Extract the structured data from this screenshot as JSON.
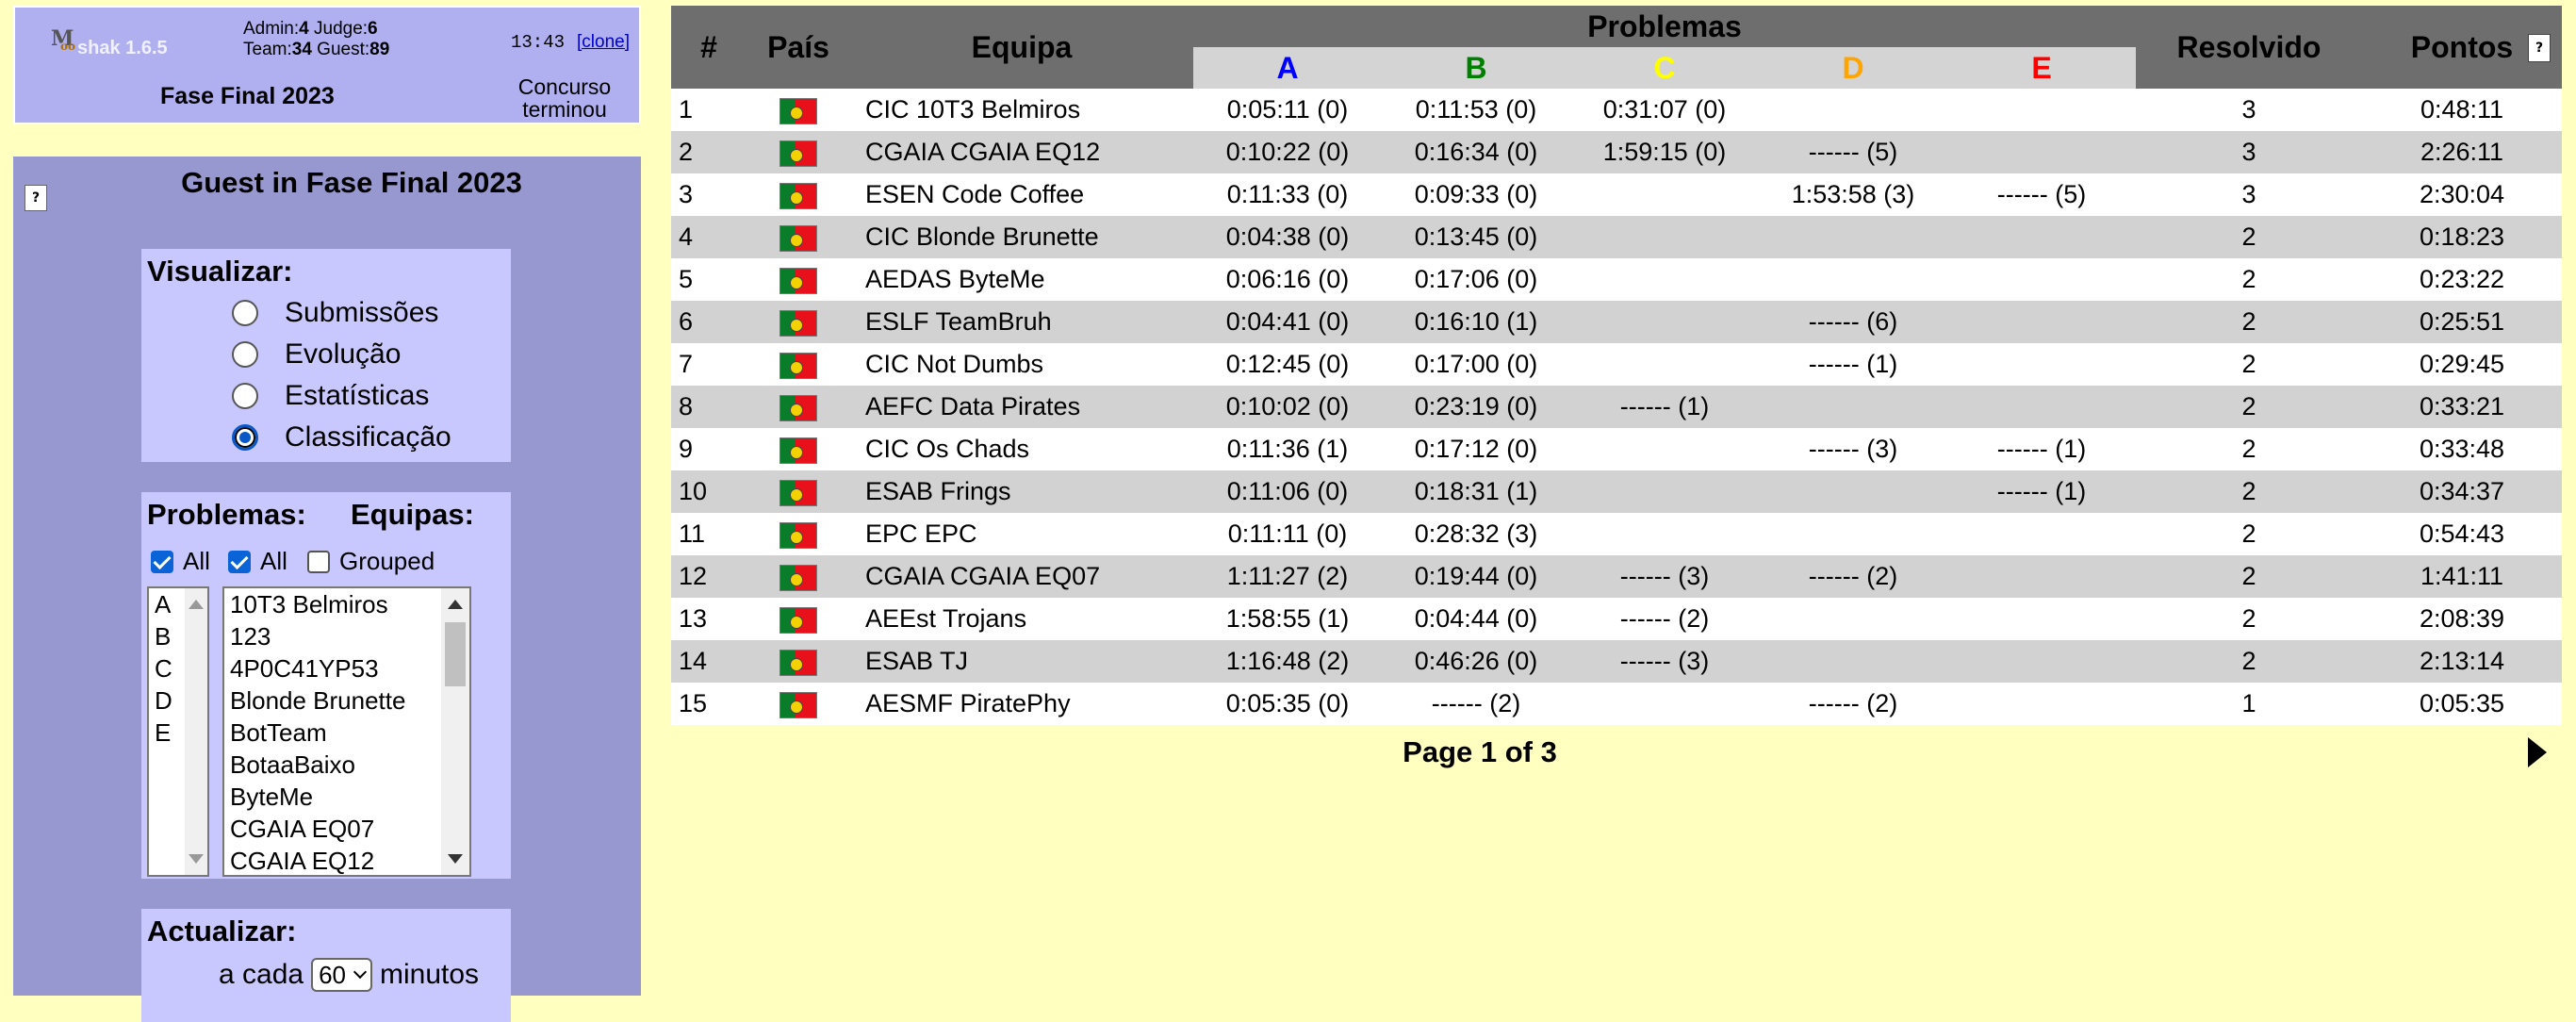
{
  "header": {
    "app_name": "shak 1.6.5",
    "logo_letter": "M",
    "logo_sub": "oo",
    "counts": {
      "admin_label": "Admin:",
      "admin": "4",
      "judge_label": "Judge:",
      "judge": "6",
      "team_label": "Team:",
      "team": "34",
      "guest_label": "Guest:",
      "guest": "89"
    },
    "clock": "13:43",
    "clone_label": "[clone]",
    "contest_name": "Fase Final 2023",
    "contest_status_line1": "Concurso",
    "contest_status_line2": "terminou"
  },
  "sidebar": {
    "title": "Guest in Fase Final 2023",
    "help_icon": "?",
    "view": {
      "title": "Visualizar:",
      "options": [
        "Submissões",
        "Evolução",
        "Estatísticas",
        "Classificação"
      ],
      "selected": "Classificação"
    },
    "filters": {
      "problems_title": "Problemas:",
      "teams_title": "Equipas:",
      "problems_all_label": "All",
      "teams_all_label": "All",
      "grouped_label": "Grouped",
      "problems": [
        "A",
        "B",
        "C",
        "D",
        "E"
      ],
      "teams": [
        "10T3 Belmiros",
        "123",
        "4P0C41YP53",
        "Blonde Brunette",
        "BotTeam",
        "BotaaBaixo",
        "ByteMe",
        "CGAIA EQ07",
        "CGAIA EQ12"
      ]
    },
    "refresh": {
      "title": "Actualizar:",
      "prefix": "a cada",
      "value": "60",
      "suffix": "minutos"
    }
  },
  "scoreboard": {
    "headers": {
      "rank": "#",
      "country": "País",
      "team": "Equipa",
      "problems": "Problemas",
      "solved": "Resolvido",
      "points": "Pontos"
    },
    "help_icon": "?",
    "problem_letters": [
      {
        "letter": "A",
        "color": "#0000ff"
      },
      {
        "letter": "B",
        "color": "#008000"
      },
      {
        "letter": "C",
        "color": "#ffff00"
      },
      {
        "letter": "D",
        "color": "#ffa500"
      },
      {
        "letter": "E",
        "color": "#ff0000"
      }
    ],
    "rows": [
      {
        "rank": "1",
        "team": "CIC 10T3 Belmiros",
        "A": "0:05:11 (0)",
        "B": "0:11:53 (0)",
        "C": "0:31:07 (0)",
        "D": "",
        "E": "",
        "solved": "3",
        "points": "0:48:11"
      },
      {
        "rank": "2",
        "team": "CGAIA CGAIA EQ12",
        "A": "0:10:22 (0)",
        "B": "0:16:34 (0)",
        "C": "1:59:15 (0)",
        "D": "------ (5)",
        "E": "",
        "solved": "3",
        "points": "2:26:11"
      },
      {
        "rank": "3",
        "team": "ESEN Code Coffee",
        "A": "0:11:33 (0)",
        "B": "0:09:33 (0)",
        "C": "",
        "D": "1:53:58 (3)",
        "E": "------ (5)",
        "solved": "3",
        "points": "2:30:04"
      },
      {
        "rank": "4",
        "team": "CIC Blonde Brunette",
        "A": "0:04:38 (0)",
        "B": "0:13:45 (0)",
        "C": "",
        "D": "",
        "E": "",
        "solved": "2",
        "points": "0:18:23"
      },
      {
        "rank": "5",
        "team": "AEDAS ByteMe",
        "A": "0:06:16 (0)",
        "B": "0:17:06 (0)",
        "C": "",
        "D": "",
        "E": "",
        "solved": "2",
        "points": "0:23:22"
      },
      {
        "rank": "6",
        "team": "ESLF TeamBruh",
        "A": "0:04:41 (0)",
        "B": "0:16:10 (1)",
        "C": "",
        "D": "------ (6)",
        "E": "",
        "solved": "2",
        "points": "0:25:51"
      },
      {
        "rank": "7",
        "team": "CIC Not Dumbs",
        "A": "0:12:45 (0)",
        "B": "0:17:00 (0)",
        "C": "",
        "D": "------ (1)",
        "E": "",
        "solved": "2",
        "points": "0:29:45"
      },
      {
        "rank": "8",
        "team": "AEFC Data Pirates",
        "A": "0:10:02 (0)",
        "B": "0:23:19 (0)",
        "C": "------ (1)",
        "D": "",
        "E": "",
        "solved": "2",
        "points": "0:33:21"
      },
      {
        "rank": "9",
        "team": "CIC Os Chads",
        "A": "0:11:36 (1)",
        "B": "0:17:12 (0)",
        "C": "",
        "D": "------ (3)",
        "E": "------ (1)",
        "solved": "2",
        "points": "0:33:48"
      },
      {
        "rank": "10",
        "team": "ESAB Frings",
        "A": "0:11:06 (0)",
        "B": "0:18:31 (1)",
        "C": "",
        "D": "",
        "E": "------ (1)",
        "solved": "2",
        "points": "0:34:37"
      },
      {
        "rank": "11",
        "team": "EPC EPC",
        "A": "0:11:11 (0)",
        "B": "0:28:32 (3)",
        "C": "",
        "D": "",
        "E": "",
        "solved": "2",
        "points": "0:54:43"
      },
      {
        "rank": "12",
        "team": "CGAIA CGAIA EQ07",
        "A": "1:11:27 (2)",
        "B": "0:19:44 (0)",
        "C": "------ (3)",
        "D": "------ (2)",
        "E": "",
        "solved": "2",
        "points": "1:41:11"
      },
      {
        "rank": "13",
        "team": "AEEst Trojans",
        "A": "1:58:55 (1)",
        "B": "0:04:44 (0)",
        "C": "------ (2)",
        "D": "",
        "E": "",
        "solved": "2",
        "points": "2:08:39"
      },
      {
        "rank": "14",
        "team": "ESAB TJ",
        "A": "1:16:48 (2)",
        "B": "0:46:26 (0)",
        "C": "------ (3)",
        "D": "",
        "E": "",
        "solved": "2",
        "points": "2:13:14"
      },
      {
        "rank": "15",
        "team": "AESMF PiratePhy",
        "A": "0:05:35 (0)",
        "B": "------ (2)",
        "C": "",
        "D": "------ (2)",
        "E": "",
        "solved": "1",
        "points": "0:05:35"
      }
    ],
    "page_label": "Page 1 of 3"
  }
}
